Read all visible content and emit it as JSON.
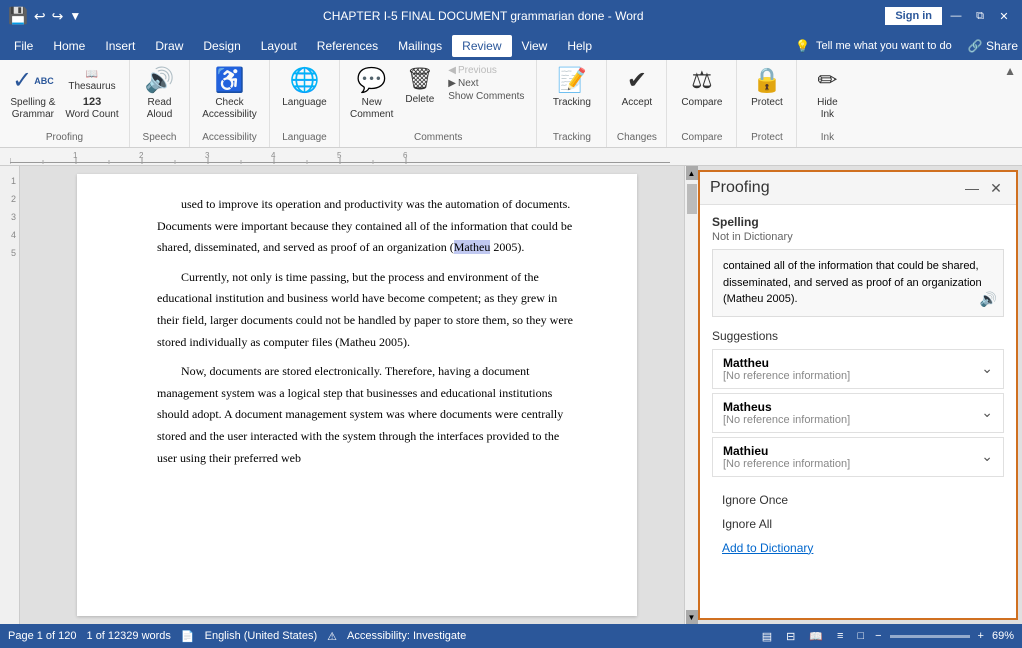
{
  "titlebar": {
    "title": "CHAPTER I-5 FINAL DOCUMENT grammarian done - Word",
    "signin": "Sign in"
  },
  "menubar": {
    "items": [
      "File",
      "Home",
      "Insert",
      "Draw",
      "Design",
      "Layout",
      "References",
      "Mailings",
      "Review",
      "View",
      "Help"
    ],
    "active": "Review",
    "search_placeholder": "Tell me what you want to do",
    "share": "Share"
  },
  "ribbon": {
    "groups": [
      {
        "name": "Proofing",
        "buttons": [
          {
            "id": "spelling",
            "label": "Spelling &\nGrammar",
            "icon": "✓"
          },
          {
            "id": "thesaurus",
            "label": "Thesaurus",
            "icon": "📖"
          },
          {
            "id": "wordcount",
            "label": "Word Count",
            "icon": "123"
          }
        ]
      },
      {
        "name": "Speech",
        "buttons": [
          {
            "id": "readaloud",
            "label": "Read\nAloud",
            "icon": "🔊"
          }
        ]
      },
      {
        "name": "Accessibility",
        "buttons": [
          {
            "id": "checkacc",
            "label": "Check\nAccessibility",
            "icon": "♿"
          }
        ]
      },
      {
        "name": "Language",
        "buttons": [
          {
            "id": "language",
            "label": "Language",
            "icon": "🌐"
          }
        ]
      },
      {
        "name": "Comments",
        "buttons": [
          {
            "id": "newcomment",
            "label": "New\nComment",
            "icon": "💬"
          },
          {
            "id": "delete",
            "label": "Delete",
            "icon": "🗑"
          },
          {
            "id": "previous",
            "label": "Previous",
            "icon": "◀"
          },
          {
            "id": "next",
            "label": "Next",
            "icon": "▶"
          },
          {
            "id": "showcomments",
            "label": "Show Comments",
            "icon": ""
          }
        ]
      },
      {
        "name": "Tracking",
        "buttons": [
          {
            "id": "tracking",
            "label": "Tracking",
            "icon": "📝"
          }
        ]
      },
      {
        "name": "Changes",
        "buttons": [
          {
            "id": "accept",
            "label": "Accept",
            "icon": "✔"
          }
        ]
      },
      {
        "name": "Compare",
        "buttons": [
          {
            "id": "compare",
            "label": "Compare",
            "icon": "⚖"
          }
        ]
      },
      {
        "name": "Protect",
        "buttons": [
          {
            "id": "protect",
            "label": "Protect",
            "icon": "🔒"
          }
        ]
      },
      {
        "name": "Ink",
        "buttons": [
          {
            "id": "hideink",
            "label": "Hide\nInk",
            "icon": "✏"
          }
        ]
      }
    ]
  },
  "document": {
    "para1": "used to improve its operation and productivity was the automation of documents. Documents were important because they contained all of the information that could be shared, disseminated, and served as proof of an organization (Matheu 2005).",
    "para2": "Currently, not only is time passing, but the process and environment of the educational institution and business world have become competent; as they grew in their field, larger documents could not be handled by paper to store them, so they were stored individually as computer files (Matheu 2005).",
    "para3": "Now, documents are stored electronically. Therefore, having a document management system was a logical step that businesses and educational institutions should adopt. A document management system was where documents were centrally stored and the user interacted with the system through the interfaces provided to the user using their preferred web"
  },
  "proofing": {
    "title": "Proofing",
    "section": "Spelling",
    "sublabel": "Not in Dictionary",
    "context": "contained all of the information that could be shared, disseminated, and served as proof of an organization (Matheu 2005).",
    "suggestions_label": "Suggestions",
    "suggestions": [
      {
        "word": "Mattheu",
        "ref": "[No reference information]"
      },
      {
        "word": "Matheus",
        "ref": "[No reference information]"
      },
      {
        "word": "Mathieu",
        "ref": "[No reference information]"
      }
    ],
    "actions": [
      "Ignore Once",
      "Ignore All",
      "Add to Dictionary"
    ]
  },
  "statusbar": {
    "page": "Page 1 of 120",
    "words": "1 of 12329 words",
    "language": "English (United States)",
    "accessibility": "Accessibility: Investigate",
    "zoom": "69%"
  }
}
